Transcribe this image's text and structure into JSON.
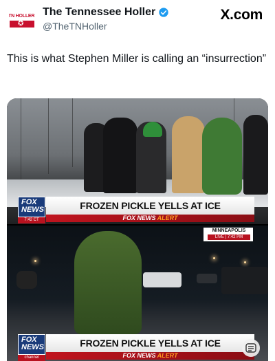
{
  "account": {
    "name": "The Tennessee Holler",
    "handle": "@TheTNHoller",
    "avatar_text": "TN HOLLER"
  },
  "brand_watermark": "X.com",
  "tweet": {
    "text": "This is what Stephen Miller is calling an “insurrection”"
  },
  "media": {
    "frame1": {
      "network_top": "FOX",
      "network_bottom": "NEWS",
      "time": "7:42 CT",
      "headline": "FROZEN PICKLE YELLS AT ICE",
      "alert_part1": "FOX NEWS",
      "alert_part2": "ALERT"
    },
    "frame2": {
      "network_top": "FOX",
      "network_bottom": "NEWS",
      "channel": "channel",
      "headline": "FROZEN PICKLE YELLS AT ICE",
      "alert_part1": "FOX NEWS",
      "alert_part2": "ALERT",
      "location": "MINNEAPOLIS",
      "live": "LIVE",
      "live_time": "7:42 PM"
    }
  },
  "colors": {
    "verified": "#1d9bf0",
    "fox_blue": "#1a3b7a",
    "alert_red": "#c0141e",
    "pickle_green": "#3f7a34"
  },
  "icons": {
    "verified": "verified-badge-icon",
    "captions": "captions-icon"
  }
}
